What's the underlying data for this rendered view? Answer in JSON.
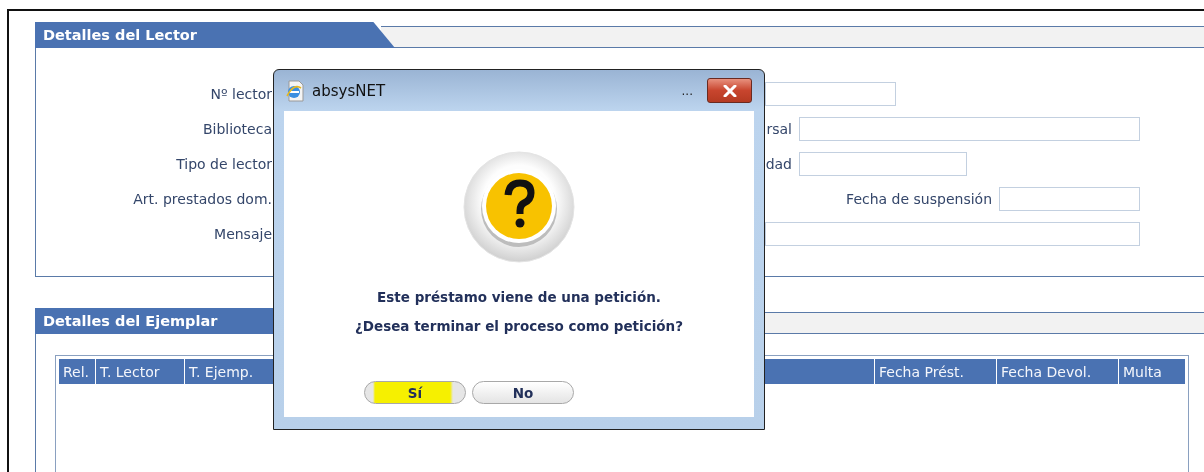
{
  "lector_panel": {
    "title": "Detalles del Lector",
    "rows": [
      {
        "label": "Nº lector",
        "kind": "field"
      },
      {
        "label": "Biblioteca",
        "kind": "labeled",
        "right_label": "rsal"
      },
      {
        "label": "Tipo de lector",
        "kind": "labeled",
        "right_label": "dad"
      },
      {
        "label": "Art. prestados dom.",
        "kind": "labeled",
        "right_label": "Fecha de suspensión"
      },
      {
        "label": "Mensaje",
        "kind": "field"
      }
    ]
  },
  "ejemplar_panel": {
    "title": "Detalles del Ejemplar",
    "table": {
      "columns_left": [
        "Rel.",
        "T. Lector",
        "T. Ejemp."
      ],
      "columns_right": [
        "Fecha Prést.",
        "Fecha Devol.",
        "Multa"
      ]
    }
  },
  "dialog": {
    "title": "absysNET",
    "title_more": "...",
    "message": [
      "Este préstamo viene de una petición.",
      "¿Desea terminar el proceso como petición?"
    ],
    "buttons": [
      {
        "label": "Sí",
        "highlighted": true
      },
      {
        "label": "No",
        "highlighted": false
      }
    ]
  }
}
